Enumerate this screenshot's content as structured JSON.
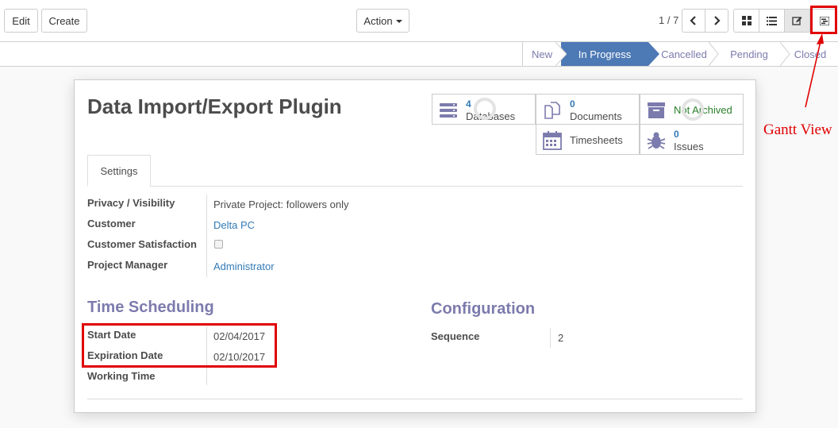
{
  "toolbar": {
    "edit_label": "Edit",
    "create_label": "Create",
    "action_label": "Action"
  },
  "pager": {
    "text": "1 / 7"
  },
  "view_switcher": [
    "kanban-icon",
    "list-icon",
    "form-icon",
    "gantt-icon"
  ],
  "statusbar": {
    "stages": [
      "New",
      "In Progress",
      "Cancelled",
      "Pending",
      "Closed"
    ],
    "active": "In Progress"
  },
  "record": {
    "title": "Data Import/Export Plugin"
  },
  "smart_buttons": {
    "databases": {
      "count": "4",
      "label": "Databases"
    },
    "documents": {
      "count": "0",
      "label": "Documents"
    },
    "archive": {
      "label": "Not Archived"
    },
    "timesheets": {
      "label": "Timesheets"
    },
    "issues": {
      "count": "0",
      "label": "Issues"
    }
  },
  "tabs": {
    "settings": "Settings"
  },
  "fields": {
    "privacy_label": "Privacy / Visibility",
    "privacy_value": "Private Project: followers only",
    "customer_label": "Customer",
    "customer_value": "Delta PC",
    "satisfaction_label": "Customer Satisfaction",
    "manager_label": "Project Manager",
    "manager_value": "Administrator"
  },
  "time_scheduling": {
    "title": "Time Scheduling",
    "start_label": "Start Date",
    "start_value": "02/04/2017",
    "expiration_label": "Expiration Date",
    "expiration_value": "02/10/2017",
    "working_label": "Working Time"
  },
  "configuration": {
    "title": "Configuration",
    "sequence_label": "Sequence",
    "sequence_value": "2"
  },
  "annotation": {
    "text": "Gantt View"
  },
  "colors": {
    "accent": "#7c7bad",
    "active_stage": "#4d79b5",
    "annotation": "#e00000",
    "link": "#337ab7"
  }
}
